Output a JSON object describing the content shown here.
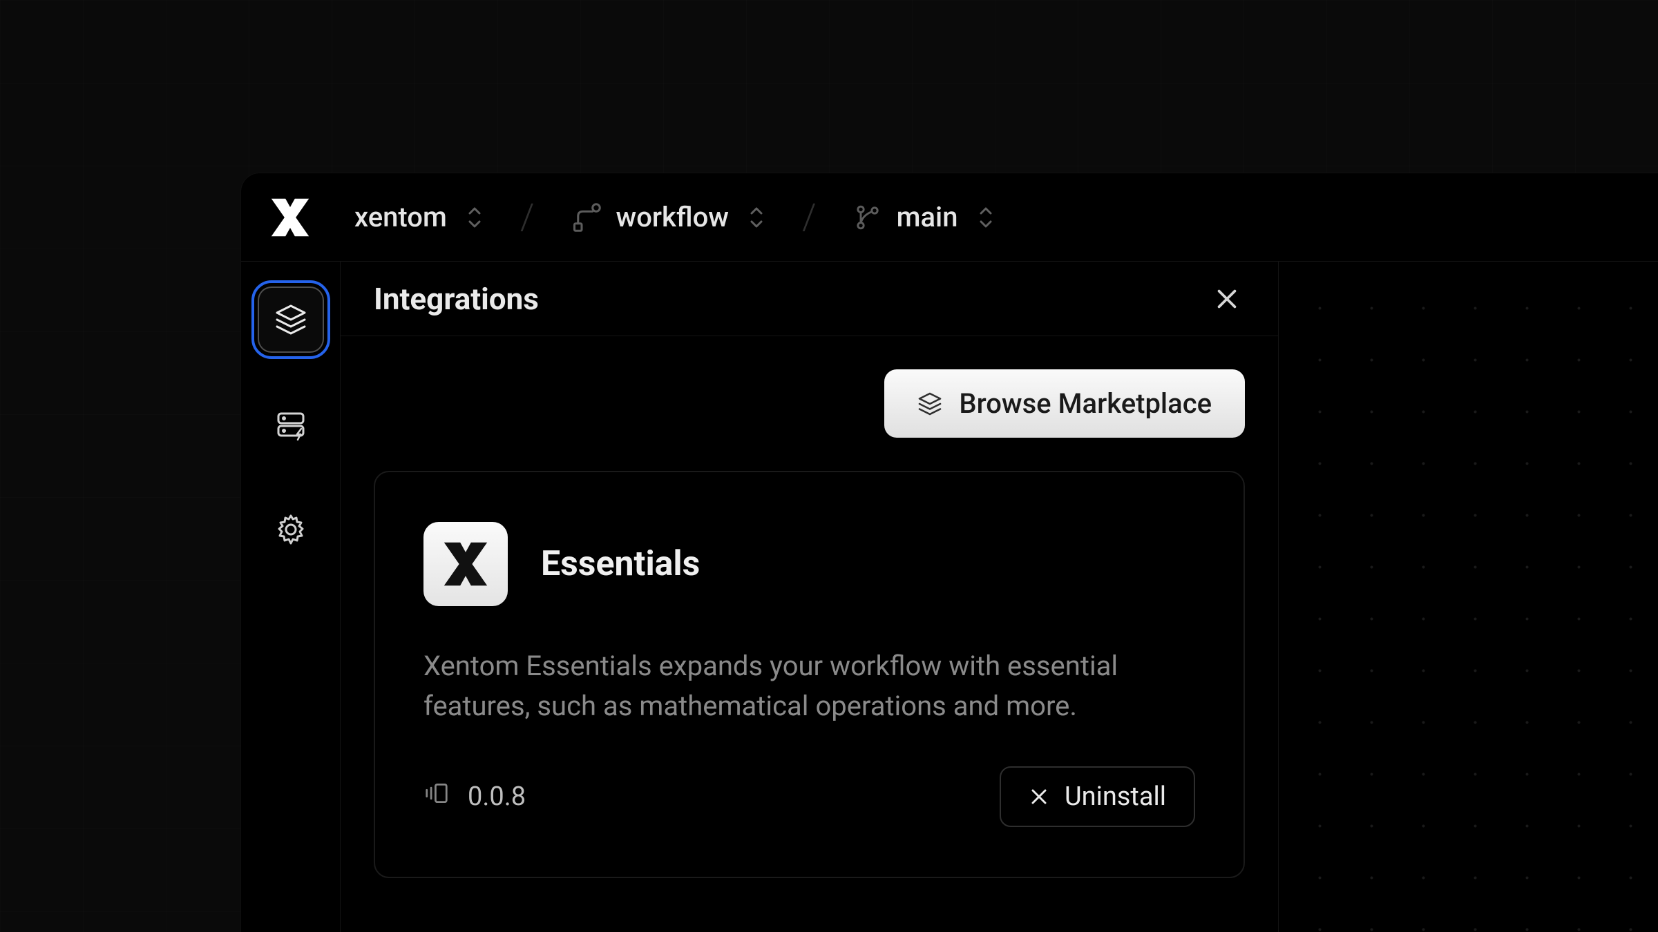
{
  "breadcrumb": {
    "org": "xentom",
    "project": "workflow",
    "branch": "main"
  },
  "panel": {
    "title": "Integrations",
    "browse_label": "Browse Marketplace"
  },
  "integration": {
    "name": "Essentials",
    "description": "Xentom Essentials expands your workflow with essential features, such as mathematical operations and more.",
    "version": "0.0.8",
    "uninstall_label": "Uninstall"
  }
}
